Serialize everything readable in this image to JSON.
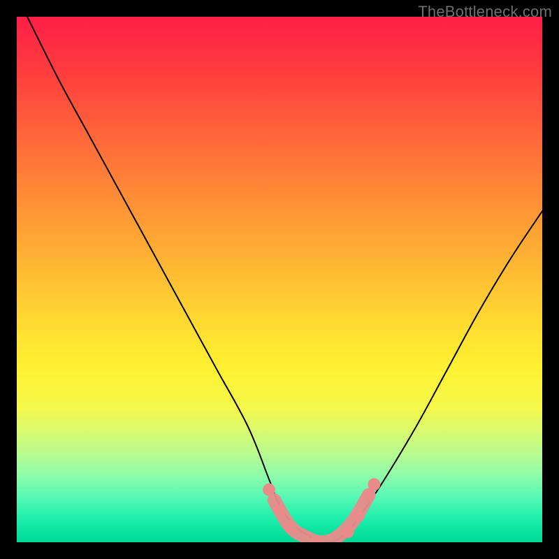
{
  "watermark": "TheBottleneck.com",
  "chart_data": {
    "type": "line",
    "title": "",
    "xlabel": "",
    "ylabel": "",
    "xlim": [
      0,
      100
    ],
    "ylim": [
      0,
      100
    ],
    "grid": false,
    "legend": false,
    "series": [
      {
        "name": "bottleneck-curve",
        "color": "#000000",
        "x": [
          2,
          8,
          14,
          20,
          26,
          32,
          38,
          44,
          48,
          50,
          53,
          56,
          58,
          60,
          63,
          66,
          70,
          76,
          82,
          88,
          94,
          100
        ],
        "y": [
          100,
          88,
          77,
          66,
          55,
          44,
          33,
          22,
          12,
          7,
          3,
          1,
          0,
          0,
          2,
          6,
          12,
          22,
          33,
          44,
          54,
          63
        ]
      }
    ],
    "markers": [
      {
        "name": "marker-left-1",
        "x": 48,
        "y": 10,
        "r": 1.2,
        "color": "#e98b8b"
      },
      {
        "name": "marker-left-2",
        "x": 50,
        "y": 6,
        "r": 1.2,
        "color": "#e98b8b"
      },
      {
        "name": "marker-left-3",
        "x": 52,
        "y": 3,
        "r": 1.2,
        "color": "#e98b8b"
      },
      {
        "name": "marker-valley",
        "x": 57,
        "y": 0,
        "r": 1.2,
        "color": "#e98b8b"
      },
      {
        "name": "marker-right-1",
        "x": 63,
        "y": 2,
        "r": 1.2,
        "color": "#e98b8b"
      },
      {
        "name": "marker-right-2",
        "x": 65,
        "y": 5,
        "r": 1.2,
        "color": "#e98b8b"
      },
      {
        "name": "marker-right-3",
        "x": 67,
        "y": 9,
        "r": 1.2,
        "color": "#e98b8b"
      },
      {
        "name": "marker-right-4",
        "x": 68,
        "y": 11,
        "r": 1.2,
        "color": "#e98b8b"
      }
    ],
    "valley_segment": {
      "name": "valley-band",
      "color": "#e98b8b",
      "width": 2.6,
      "points": [
        {
          "x": 49,
          "y": 8
        },
        {
          "x": 52,
          "y": 3
        },
        {
          "x": 55,
          "y": 1
        },
        {
          "x": 58,
          "y": 0
        },
        {
          "x": 61,
          "y": 1
        },
        {
          "x": 64,
          "y": 4
        },
        {
          "x": 67,
          "y": 9
        }
      ]
    },
    "background_gradient": {
      "top": "#ff1f47",
      "mid": "#ffe233",
      "bottom": "#00d996"
    }
  }
}
